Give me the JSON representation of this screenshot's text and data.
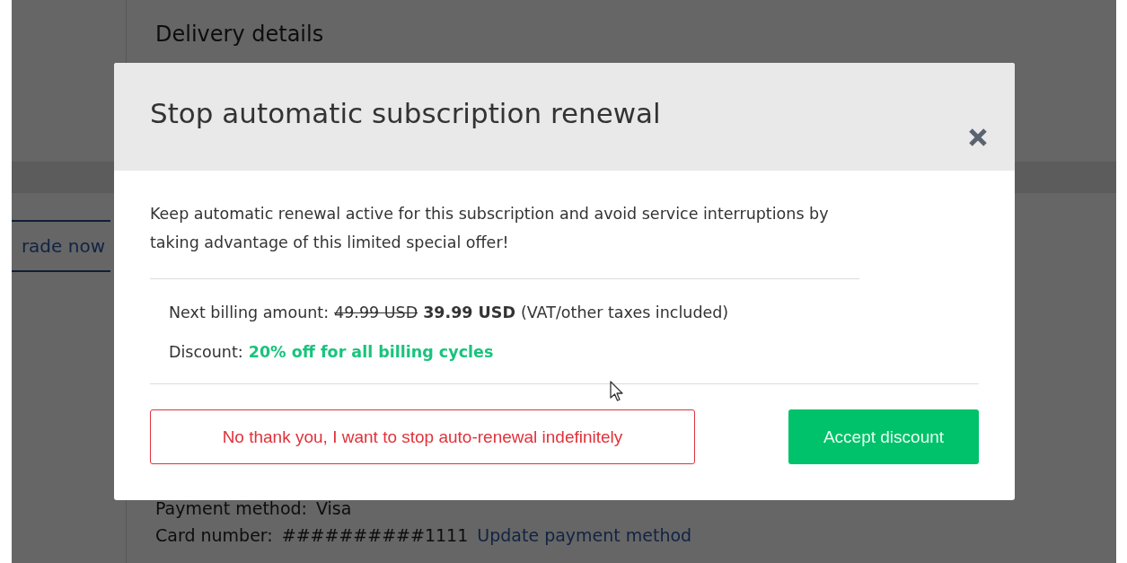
{
  "background": {
    "sidebar_button": "rade now",
    "section_title": "Delivery details",
    "payment_method": {
      "label": "Payment method:",
      "value": "Visa"
    },
    "card_number": {
      "label": "Card number:",
      "value": "##########1111",
      "link": "Update payment method"
    }
  },
  "dialog": {
    "title": "Stop automatic subscription renewal",
    "message": "Keep automatic renewal active for this subscription and avoid service interruptions by taking advantage of this limited special offer!",
    "billing": {
      "label": "Next billing amount:",
      "old_price": "49.99 USD",
      "new_price": "39.99 USD",
      "note": "(VAT/other taxes included)"
    },
    "discount": {
      "label": "Discount:",
      "value": "20% off for all billing cycles"
    },
    "buttons": [
      {
        "label": "No thank you, I want to stop auto-renewal indefinitely",
        "kind": "decline"
      },
      {
        "label": "Accept discount",
        "kind": "accept"
      }
    ]
  }
}
